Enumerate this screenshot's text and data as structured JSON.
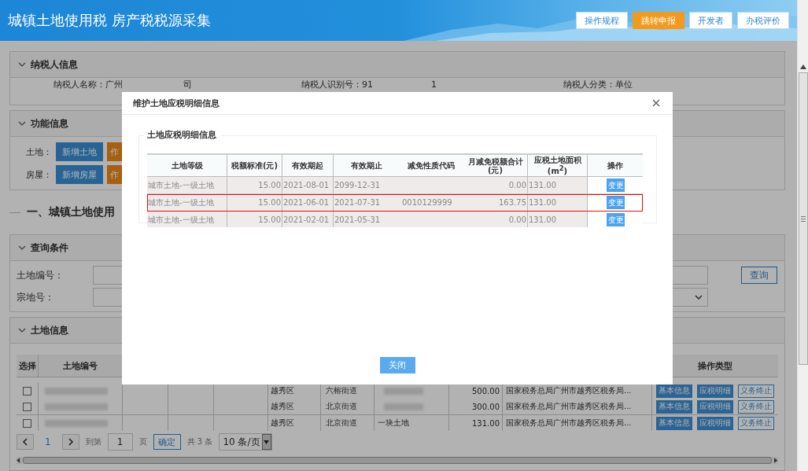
{
  "header": {
    "title": "城镇土地使用税 房产税税源采集",
    "buttons": [
      {
        "label": "操作规程",
        "kind": "default"
      },
      {
        "label": "跳转申报",
        "kind": "primary"
      },
      {
        "label": "开发者",
        "kind": "default"
      },
      {
        "label": "办税评价",
        "kind": "default"
      }
    ]
  },
  "taxpayer_panel": {
    "title": "纳税人信息",
    "fields": [
      "纳税人名称：广州",
      "司",
      "纳税人识别号：91",
      "1",
      "纳税人分类：单位"
    ]
  },
  "function_panel": {
    "title": "功能信息",
    "rows": [
      {
        "label": "土地：",
        "buttons": [
          {
            "label": "新增土地",
            "kind": "primary"
          },
          {
            "label": "作",
            "kind": "warning"
          }
        ]
      },
      {
        "label": "房屋：",
        "buttons": [
          {
            "label": "新增房屋",
            "kind": "primary"
          },
          {
            "label": "作",
            "kind": "warning"
          }
        ]
      }
    ]
  },
  "section_heading": "一、城镇土地使用",
  "query_panel": {
    "title": "查询条件",
    "fields": [
      {
        "label": "土地编号：",
        "kind": "input"
      },
      {
        "label": "宗地号：",
        "kind": "select"
      }
    ],
    "search_button": "查询"
  },
  "land_panel": {
    "title": "土地信息",
    "columns": {
      "select": "选择",
      "land_no": "土地编号",
      "actions": "操作类型"
    },
    "rows": [
      {
        "checked": false,
        "district": "越秀区",
        "street": "六榕街道",
        "amount": "500.00",
        "authority": "国家税务总局广州市越秀区税务局...",
        "actions": [
          {
            "label": "基本信息",
            "kind": "filled"
          },
          {
            "label": "应税明细",
            "kind": "filled"
          },
          {
            "label": "义务终止",
            "kind": "outline"
          }
        ]
      },
      {
        "checked": false,
        "district": "越秀区",
        "street": "北京街道",
        "amount": "300.00",
        "authority": "国家税务总局广州市越秀区税务局...",
        "actions": [
          {
            "label": "基本信息",
            "kind": "filled"
          },
          {
            "label": "应税明细",
            "kind": "filled"
          },
          {
            "label": "义务终止",
            "kind": "outline"
          }
        ]
      },
      {
        "checked": false,
        "district": "越秀区",
        "street": "北京街道",
        "name": "一块土地",
        "amount": "131.00",
        "authority": "国家税务总局广州市越秀区税务局...",
        "actions": [
          {
            "label": "基本信息",
            "kind": "filled"
          },
          {
            "label": "应税明细",
            "kind": "filled"
          },
          {
            "label": "义务终止",
            "kind": "outline"
          }
        ]
      }
    ]
  },
  "pagination": {
    "page": "1",
    "goto_label": "到第",
    "goto_value": "1",
    "page_unit": "页",
    "confirm": "确定",
    "total": "共 3 条",
    "page_size": "10 条/页"
  },
  "modal": {
    "title": "维护土地应税明细信息",
    "fieldset": "土地应税明细信息",
    "columns": [
      "土地等级",
      "税额标准(元)",
      "有效期起",
      "有效期止",
      "减免性质代码",
      "月减免税额合计(元)",
      "应税土地面积(m$^{2}$)",
      "操作"
    ],
    "rows": [
      {
        "selected": false,
        "grade": "城市土地-一级土地",
        "rate": "15.00",
        "start": "2021-08-01",
        "end": "2099-12-31",
        "relief_amount": "0.00",
        "area": "131.00",
        "action": "变更"
      },
      {
        "selected": true,
        "grade": "城市土地-一级土地",
        "rate": "15.00",
        "start": "2021-06-01",
        "end": "2021-07-31",
        "relief_code": "0010129999",
        "relief_amount": "163.75",
        "area": "131.00",
        "action": "变更"
      },
      {
        "selected": false,
        "grade": "城市土地-一级土地",
        "rate": "15.00",
        "start": "2021-02-01",
        "end": "2021-05-31",
        "relief_amount": "0.00",
        "area": "131.00",
        "action": "变更"
      }
    ],
    "close_button": "关闭"
  }
}
